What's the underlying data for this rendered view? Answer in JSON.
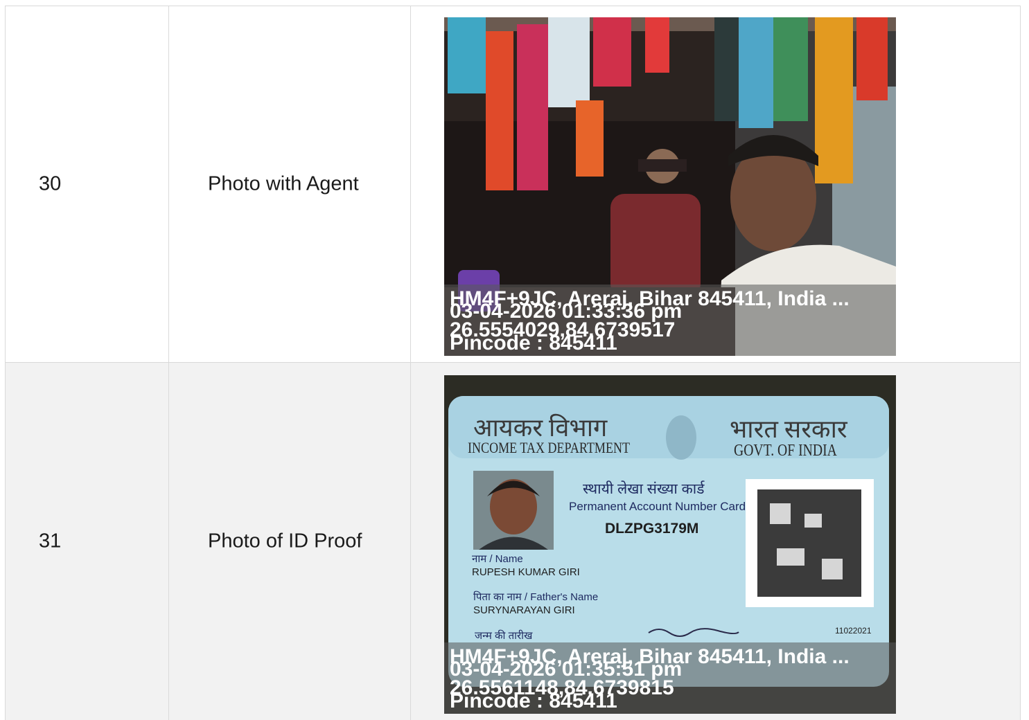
{
  "rows": [
    {
      "number": "30",
      "label": "Photo with Agent",
      "photo": {
        "address": "HM4F+9JC, Areraj, Bihar 845411, India ...",
        "datetime": "03-04-2026 01:33:36 pm",
        "coords": "26.5554029,84.6739517",
        "pincode": "Pincode : 845411"
      }
    },
    {
      "number": "31",
      "label": "Photo of ID Proof",
      "photo": {
        "address": "HM4F+9JC, Areraj, Bihar 845411, India ...",
        "datetime": "03-04-2026 01:35:51 pm",
        "coords": "26.5561148,84.6739815",
        "pincode": "Pincode : 845411",
        "card": {
          "dept_hindi": "आयकर विभाग",
          "dept_english": "INCOME TAX DEPARTMENT",
          "govt_hindi": "भारत सरकार",
          "govt_english": "GOVT. OF INDIA",
          "card_title_hindi": "स्थायी लेखा संख्या कार्ड",
          "card_title_english": "Permanent Account Number Card",
          "pan_number": "DLZPG3179M",
          "name_label": "नाम / Name",
          "name": "RUPESH KUMAR GIRI",
          "father_label": "पिता का नाम / Father's Name",
          "father_name": "SURYNARAYAN GIRI",
          "dob_label": "जन्म की तारीख",
          "issue_code": "11022021"
        }
      }
    }
  ],
  "colors": {
    "row_odd": "#ffffff",
    "row_even": "#f2f2f2",
    "border": "#d9d9d9"
  }
}
